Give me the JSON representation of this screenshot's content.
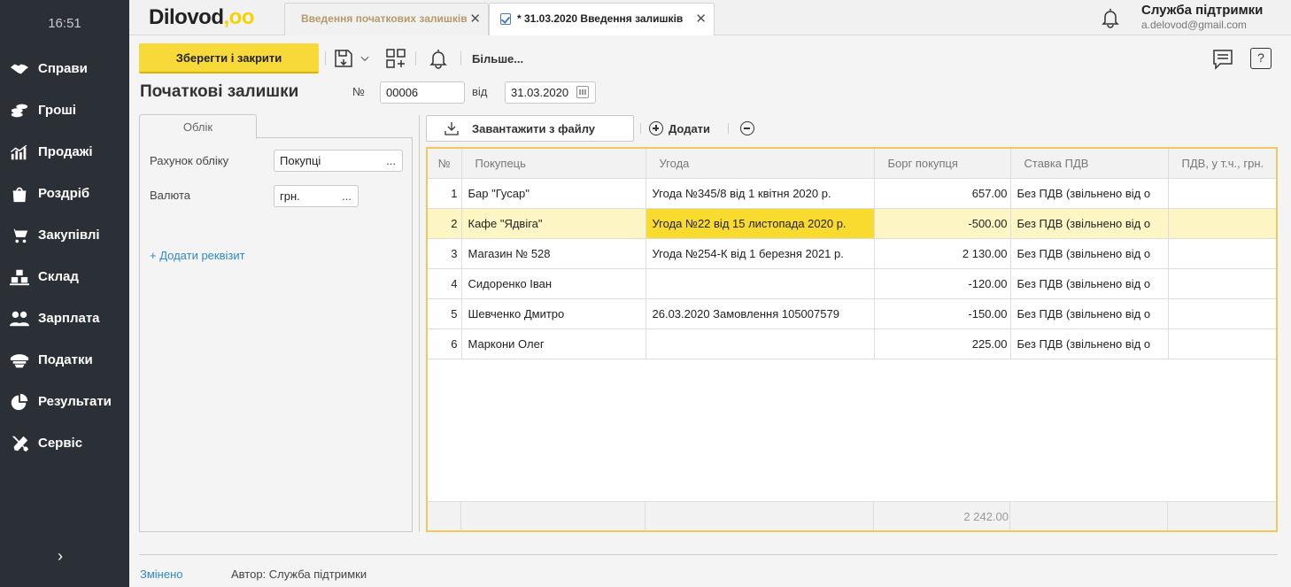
{
  "sidebar": {
    "time": "16:51",
    "items": [
      {
        "label": "Справи",
        "icon": "handshake-icon"
      },
      {
        "label": "Гроші",
        "icon": "coins-icon"
      },
      {
        "label": "Продажі",
        "icon": "chart-icon"
      },
      {
        "label": "Роздріб",
        "icon": "shopping-bag-icon"
      },
      {
        "label": "Закупівлі",
        "icon": "cart-icon"
      },
      {
        "label": "Склад",
        "icon": "boxes-icon"
      },
      {
        "label": "Зарплата",
        "icon": "people-icon"
      },
      {
        "label": "Податки",
        "icon": "cap-icon"
      },
      {
        "label": "Результати",
        "icon": "pie-icon"
      },
      {
        "label": "Сервіс",
        "icon": "tools-icon"
      }
    ],
    "expand_glyph": "›"
  },
  "header": {
    "logo_text": "Dilovod",
    "logo_dots": ",oo",
    "tabs": [
      {
        "label": "Введення початкових залишків"
      },
      {
        "label": "* 31.03.2020 Введення залишків"
      }
    ],
    "close_glyph": "✕",
    "user_name": "Служба підтримки",
    "user_email": "a.delovod@gmail.com"
  },
  "toolbar": {
    "save_close_label": "Зберегти і закрити",
    "more_label": "Більше...",
    "help_glyph": "?"
  },
  "document": {
    "title": "Початкові залишки",
    "num_label": "№",
    "num_value": "00006",
    "from_label": "від",
    "date_value": "31.03.2020"
  },
  "left_panel": {
    "tab_label": "Облік",
    "account_label": "Рахунок обліку",
    "account_value": "Покупці",
    "currency_label": "Валюта",
    "currency_value": "грн.",
    "dots": "...",
    "add_requisite": "+ Додати реквізит"
  },
  "grid_toolbar": {
    "load_label": "Завантажити з файлу",
    "add_label": "Додати"
  },
  "grid": {
    "columns": [
      "№",
      "Покупець",
      "Угода",
      "Борг покупця",
      "Ставка ПДВ",
      "ПДВ, у т.ч., грн."
    ],
    "rows": [
      {
        "n": "1",
        "buyer": "Бар \"Гусар\"",
        "deal": "Угода №345/8 від 1 квітня 2020 р.",
        "debt": "657.00",
        "vat": "Без ПДВ (звільнено від о",
        "vat_sum": ""
      },
      {
        "n": "2",
        "buyer": "Кафе \"Ядвіга\"",
        "deal": "Угода №22 від 15 листопада 2020 р.",
        "debt": "-500.00",
        "vat": "Без ПДВ (звільнено від о",
        "vat_sum": ""
      },
      {
        "n": "3",
        "buyer": "Магазин № 528",
        "deal": "Угода №254-К від 1 березня 2021 р.",
        "debt": "2 130.00",
        "vat": "Без ПДВ (звільнено від о",
        "vat_sum": ""
      },
      {
        "n": "4",
        "buyer": "Сидоренко Іван",
        "deal": "",
        "debt": "-120.00",
        "vat": "Без ПДВ (звільнено від о",
        "vat_sum": ""
      },
      {
        "n": "5",
        "buyer": "Шевченко Дмитро",
        "deal": "26.03.2020 Замовлення 105007579",
        "debt": "-150.00",
        "vat": "Без ПДВ (звільнено від о",
        "vat_sum": ""
      },
      {
        "n": "6",
        "buyer": "Маркони Олег",
        "deal": "",
        "debt": "225.00",
        "vat": "Без ПДВ (звільнено від о",
        "vat_sum": ""
      }
    ],
    "total_debt": "2 242.00"
  },
  "status": {
    "changed_label": "Змінено",
    "author_label": "Автор: Служба підтримки"
  },
  "colors": {
    "accent_yellow": "#f7d93a",
    "sidebar_bg": "#2b2f36",
    "selected_row": "#fdf6c4",
    "selected_cell": "#f9da2f",
    "link_blue": "#2f89c7"
  }
}
